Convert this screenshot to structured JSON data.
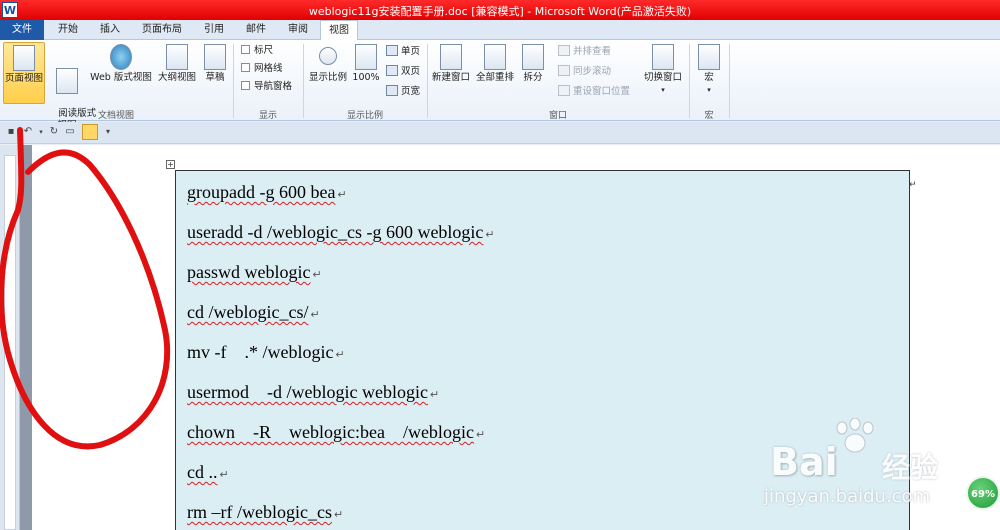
{
  "window": {
    "title": "weblogic11g安装配置手册.doc [兼容模式] - Microsoft Word(产品激活失败)",
    "app_icon": "W"
  },
  "tabs": [
    "文件",
    "开始",
    "插入",
    "页面布局",
    "引用",
    "邮件",
    "审阅",
    "视图"
  ],
  "ribbon": {
    "doc_views": {
      "label": "文档视图",
      "buttons": [
        "页面视图",
        "阅读版式\n视图",
        "Web 版式视图",
        "大纲视图",
        "草稿"
      ]
    },
    "show": {
      "label": "显示",
      "items": [
        "标尺",
        "网格线",
        "导航窗格"
      ]
    },
    "zoom": {
      "label": "显示比例",
      "zoom_btn": "显示比例",
      "pct_btn": "100%",
      "single": "单页",
      "double": "双页",
      "width": "页宽"
    },
    "window": {
      "label": "窗口",
      "new_window": "新建窗口",
      "arrange_all": "全部重排",
      "split": "拆分",
      "side_by_side": "并排查看",
      "sync_scroll": "同步滚动",
      "reset_pos": "重设窗口位置",
      "switch_windows": "切换窗口"
    },
    "macros": {
      "label": "宏",
      "btn": "宏"
    }
  },
  "document": {
    "lines": [
      "groupadd -g 600 bea",
      "useradd -d /weblogic_cs -g 600 weblogic",
      "passwd weblogic",
      "cd /weblogic_cs/",
      "mv -f    .* /weblogic",
      "usermod    -d /weblogic weblogic",
      "chown    -R    weblogic:bea    /weblogic",
      "cd ..",
      "rm –rf /weblogic_cs"
    ]
  },
  "watermark": {
    "brand": "Bai",
    "brand2": "经验",
    "url": "jingyan.baidu.com"
  },
  "zoom_badge": "69%",
  "colors": {
    "titlebar": "#e00000",
    "file_tab": "#1e5aa8",
    "cell_bg": "#dbeef4",
    "annotation": "#e01010"
  }
}
